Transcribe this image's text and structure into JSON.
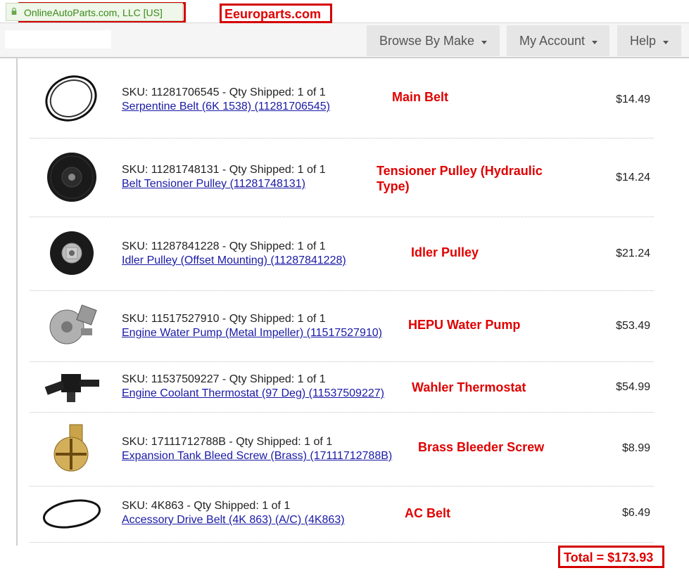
{
  "address_bar": {
    "secure_label": "OnlineAutoParts.com, LLC [US]"
  },
  "annotation_site": "Eeuroparts.com",
  "nav": {
    "items": [
      {
        "label": "Browse By Make"
      },
      {
        "label": "My Account"
      },
      {
        "label": "Help"
      }
    ]
  },
  "order": {
    "items": [
      {
        "sku": "SKU: 11281706545 - Qty Shipped: 1 of 1",
        "product": "Serpentine Belt (6K 1538) (11281706545)",
        "annotation": "Main Belt",
        "price": "$14.49",
        "image_icon": "serpentine-belt-icon"
      },
      {
        "sku": "SKU: 11281748131 - Qty Shipped: 1 of 1",
        "product": "Belt Tensioner Pulley (11281748131)",
        "annotation": "Tensioner Pulley (Hydraulic Type)",
        "price": "$14.24",
        "image_icon": "tensioner-pulley-icon"
      },
      {
        "sku": "SKU: 11287841228 - Qty Shipped: 1 of 1",
        "product": "Idler Pulley (Offset Mounting) (11287841228)",
        "annotation": "Idler Pulley",
        "price": "$21.24",
        "image_icon": "idler-pulley-icon"
      },
      {
        "sku": "SKU: 11517527910 - Qty Shipped: 1 of 1",
        "product": "Engine Water Pump (Metal Impeller) (11517527910)",
        "annotation": "HEPU Water Pump",
        "price": "$53.49",
        "image_icon": "water-pump-icon"
      },
      {
        "sku": "SKU: 11537509227 - Qty Shipped: 1 of 1",
        "product": "Engine Coolant Thermostat (97 Deg) (11537509227)",
        "annotation": "Wahler Thermostat",
        "price": "$54.99",
        "image_icon": "thermostat-icon"
      },
      {
        "sku": "SKU: 17111712788B - Qty Shipped: 1 of 1",
        "product": "Expansion Tank Bleed Screw (Brass) (17111712788B)",
        "annotation": "Brass Bleeder Screw",
        "price": "$8.99",
        "image_icon": "bleed-screw-icon"
      },
      {
        "sku": "SKU: 4K863 - Qty Shipped: 1 of 1",
        "product": "Accessory Drive Belt (4K 863) (A/C) (4K863)",
        "annotation": "AC Belt",
        "price": "$6.49",
        "image_icon": "ac-belt-icon"
      }
    ]
  },
  "total_annotation": "Total = $173.93",
  "colors": {
    "annotation_red": "#e00000",
    "link_blue": "#1a1aa6",
    "secure_green": "#3a8a1a"
  }
}
